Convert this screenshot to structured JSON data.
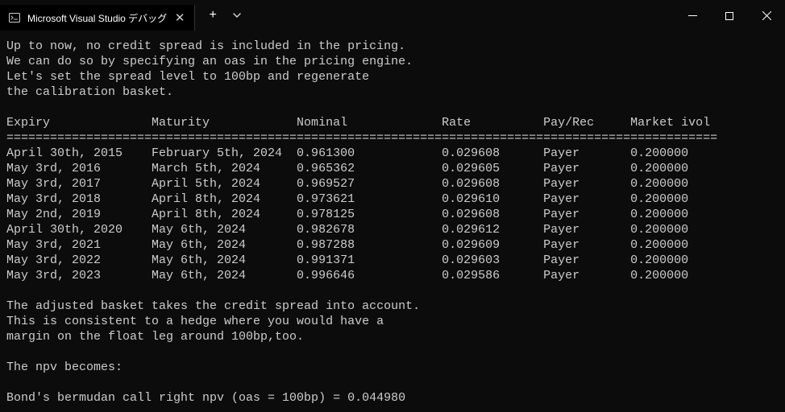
{
  "window": {
    "tab_title": "Microsoft Visual Studio デバッグ"
  },
  "content": {
    "intro": [
      "Up to now, no credit spread is included in the pricing.",
      "We can do so by specifying an oas in the pricing engine.",
      "Let's set the spread level to 100bp and regenerate",
      "the calibration basket."
    ],
    "headers": {
      "expiry": "Expiry",
      "maturity": "Maturity",
      "nominal": "Nominal",
      "rate": "Rate",
      "payrec": "Pay/Rec",
      "ivol": "Market ivol"
    },
    "separator": "==================================================================================================",
    "rows": [
      {
        "expiry": "April 30th, 2015",
        "maturity": "February 5th, 2024",
        "nominal": "0.961300",
        "rate": "0.029608",
        "payrec": "Payer",
        "ivol": "0.200000"
      },
      {
        "expiry": "May 3rd, 2016",
        "maturity": "March 5th, 2024",
        "nominal": "0.965362",
        "rate": "0.029605",
        "payrec": "Payer",
        "ivol": "0.200000"
      },
      {
        "expiry": "May 3rd, 2017",
        "maturity": "April 5th, 2024",
        "nominal": "0.969527",
        "rate": "0.029608",
        "payrec": "Payer",
        "ivol": "0.200000"
      },
      {
        "expiry": "May 3rd, 2018",
        "maturity": "April 8th, 2024",
        "nominal": "0.973621",
        "rate": "0.029610",
        "payrec": "Payer",
        "ivol": "0.200000"
      },
      {
        "expiry": "May 2nd, 2019",
        "maturity": "April 8th, 2024",
        "nominal": "0.978125",
        "rate": "0.029608",
        "payrec": "Payer",
        "ivol": "0.200000"
      },
      {
        "expiry": "April 30th, 2020",
        "maturity": "May 6th, 2024",
        "nominal": "0.982678",
        "rate": "0.029612",
        "payrec": "Payer",
        "ivol": "0.200000"
      },
      {
        "expiry": "May 3rd, 2021",
        "maturity": "May 6th, 2024",
        "nominal": "0.987288",
        "rate": "0.029609",
        "payrec": "Payer",
        "ivol": "0.200000"
      },
      {
        "expiry": "May 3rd, 2022",
        "maturity": "May 6th, 2024",
        "nominal": "0.991371",
        "rate": "0.029603",
        "payrec": "Payer",
        "ivol": "0.200000"
      },
      {
        "expiry": "May 3rd, 2023",
        "maturity": "May 6th, 2024",
        "nominal": "0.996646",
        "rate": "0.029586",
        "payrec": "Payer",
        "ivol": "0.200000"
      }
    ],
    "after": [
      "The adjusted basket takes the credit spread into account.",
      "This is consistent to a hedge where you would have a",
      "margin on the float leg around 100bp,too."
    ],
    "npv_intro": "The npv becomes:",
    "npv_line": "Bond's bermudan call right npv (oas = 100bp) = 0.044980"
  }
}
